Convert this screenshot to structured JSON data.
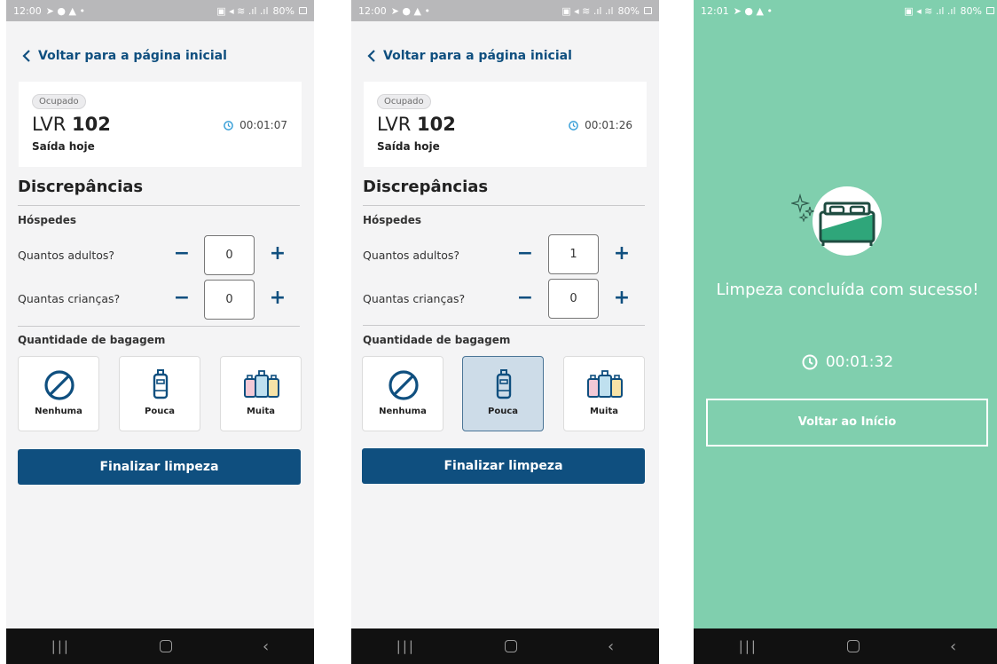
{
  "status_bar": {
    "screen1_time": "12:00",
    "screen2_time": "12:00",
    "screen3_time": "12:01",
    "battery": "80%"
  },
  "back_link": "Voltar para a página inicial",
  "room": {
    "status_badge": "Ocupado",
    "prefix": "LVR",
    "number": "102",
    "subtitle": "Saída hoje"
  },
  "timers": {
    "screen1": "00:01:07",
    "screen2": "00:01:26",
    "screen3": "00:01:32"
  },
  "discrepancies": {
    "title": "Discrepâncias",
    "guests_label": "Hóspedes",
    "adults_label": "Quantos adultos?",
    "children_label": "Quantas crianças?",
    "minus": "−",
    "plus": "+",
    "screen1": {
      "adults": "0",
      "children": "0"
    },
    "screen2": {
      "adults": "1",
      "children": "0"
    }
  },
  "luggage": {
    "label": "Quantidade de bagagem",
    "options": [
      "Nenhuma",
      "Pouca",
      "Muita"
    ],
    "selected_screen2": "Pouca"
  },
  "finish_button": "Finalizar limpeza",
  "success": {
    "title": "Limpeza concluída com sucesso!",
    "home_button": "Voltar ao Início"
  },
  "colors": {
    "primary": "#0f4f7f",
    "success_bg": "#80cfae",
    "background": "#f4f4f5",
    "selected_bg": "#cddce8"
  }
}
